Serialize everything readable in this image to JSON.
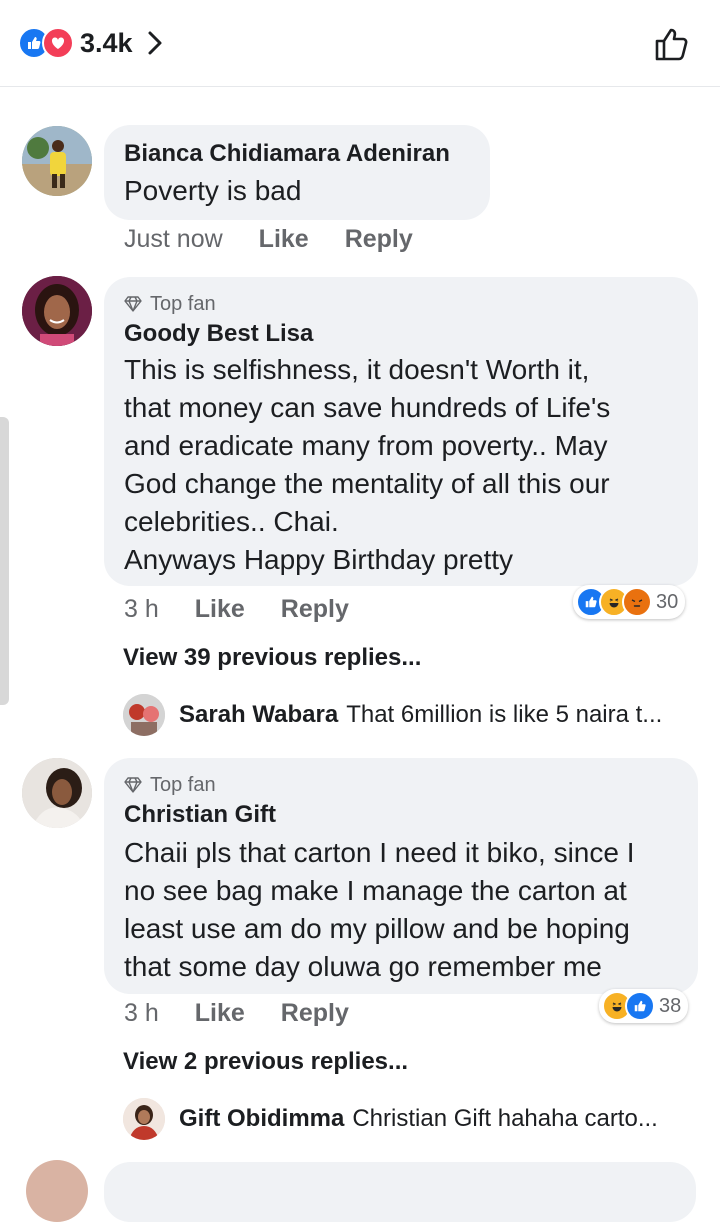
{
  "header": {
    "reaction_count": "3.4k",
    "reactions": [
      "like-icon",
      "love-icon"
    ]
  },
  "colors": {
    "like_blue": "#1877f2",
    "love_red": "#f33e58",
    "haha_yellow": "#f7b125",
    "angry_orange": "#e9710f",
    "bubble_gray": "#f0f2f5",
    "meta_gray": "#65676b"
  },
  "comments": [
    {
      "name": "Bianca Chidiamara Adeniran",
      "lines": [
        "Poverty is bad"
      ],
      "time": "Just now",
      "like_label": "Like",
      "reply_label": "Reply"
    },
    {
      "badge": "Top fan",
      "name": "Goody Best Lisa",
      "lines": [
        "This is selfishness, it doesn't Worth it,",
        "that money can save hundreds of Life's",
        "and eradicate many from poverty.. May",
        "God change the mentality of all this our",
        "celebrities.. Chai.",
        "Anyways Happy Birthday pretty"
      ],
      "time": "3 h",
      "like_label": "Like",
      "reply_label": "Reply",
      "reaction_count": "30",
      "reactions": [
        "like-icon",
        "haha-icon",
        "angry-icon"
      ],
      "view_previous": "View 39 previous replies...",
      "reply": {
        "name": "Sarah Wabara",
        "text": "That 6million is like 5 naira t..."
      }
    },
    {
      "badge": "Top fan",
      "name": "Christian Gift",
      "lines": [
        "Chaii pls that carton I need it biko, since I",
        "no see bag make I manage the carton at",
        "least use am do my pillow and be hoping",
        "that some day oluwa go remember me"
      ],
      "time": "3 h",
      "like_label": "Like",
      "reply_label": "Reply",
      "reaction_count": "38",
      "reactions": [
        "haha-icon",
        "like-icon"
      ],
      "view_previous": "View 2 previous replies...",
      "reply": {
        "name": "Gift Obidimma",
        "text": "Christian Gift hahaha carto..."
      }
    }
  ]
}
